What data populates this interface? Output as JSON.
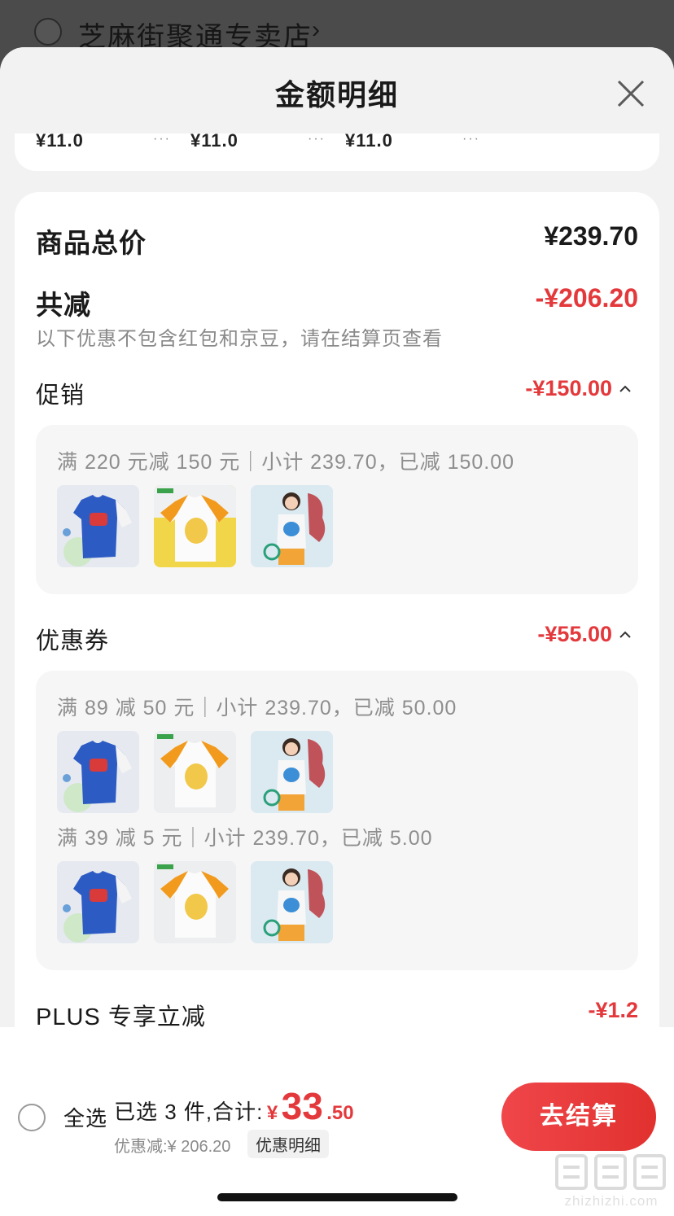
{
  "store": {
    "name": "芝麻街聚通专卖店",
    "chevron": "›"
  },
  "sheet": {
    "title": "金额明细"
  },
  "summary_card": {
    "total_label": "商品总价",
    "total_value": "¥239.70",
    "reduce_label": "共减",
    "reduce_value": "-¥206.20",
    "note": "以下优惠不包含红包和京豆，请在结算页查看"
  },
  "promotion": {
    "label": "促销",
    "value": "-¥150.00",
    "rule": "满 220 元减 150 元｜小计 239.70，已减 150.00"
  },
  "coupon": {
    "label": "优惠券",
    "value": "-¥55.00",
    "rule1": "满 89 减 50 元｜小计 239.70，已减 50.00",
    "rule2": "满 39 减 5 元｜小计 239.70，已减 5.00"
  },
  "plus": {
    "label": "PLUS 专享立减",
    "value": "-¥1.2"
  },
  "bottom": {
    "select_all": "全选",
    "selected_text": "已选 3 件,合计:",
    "currency": "¥",
    "amount_int": "33",
    "amount_dec": ".50",
    "discount_line": "优惠减:¥ 206.20",
    "detail_chip": "优惠明细",
    "checkout": "去结算"
  },
  "watermark": {
    "glyphs": "值值值",
    "sub": "zhizhizhi.com"
  },
  "colors": {
    "accent_red": "#e4393c",
    "button_red": "#e1312f"
  },
  "icons": {
    "close": "close-icon",
    "caret_up": "caret-up-icon",
    "chevron_right": "chevron-right-icon"
  }
}
